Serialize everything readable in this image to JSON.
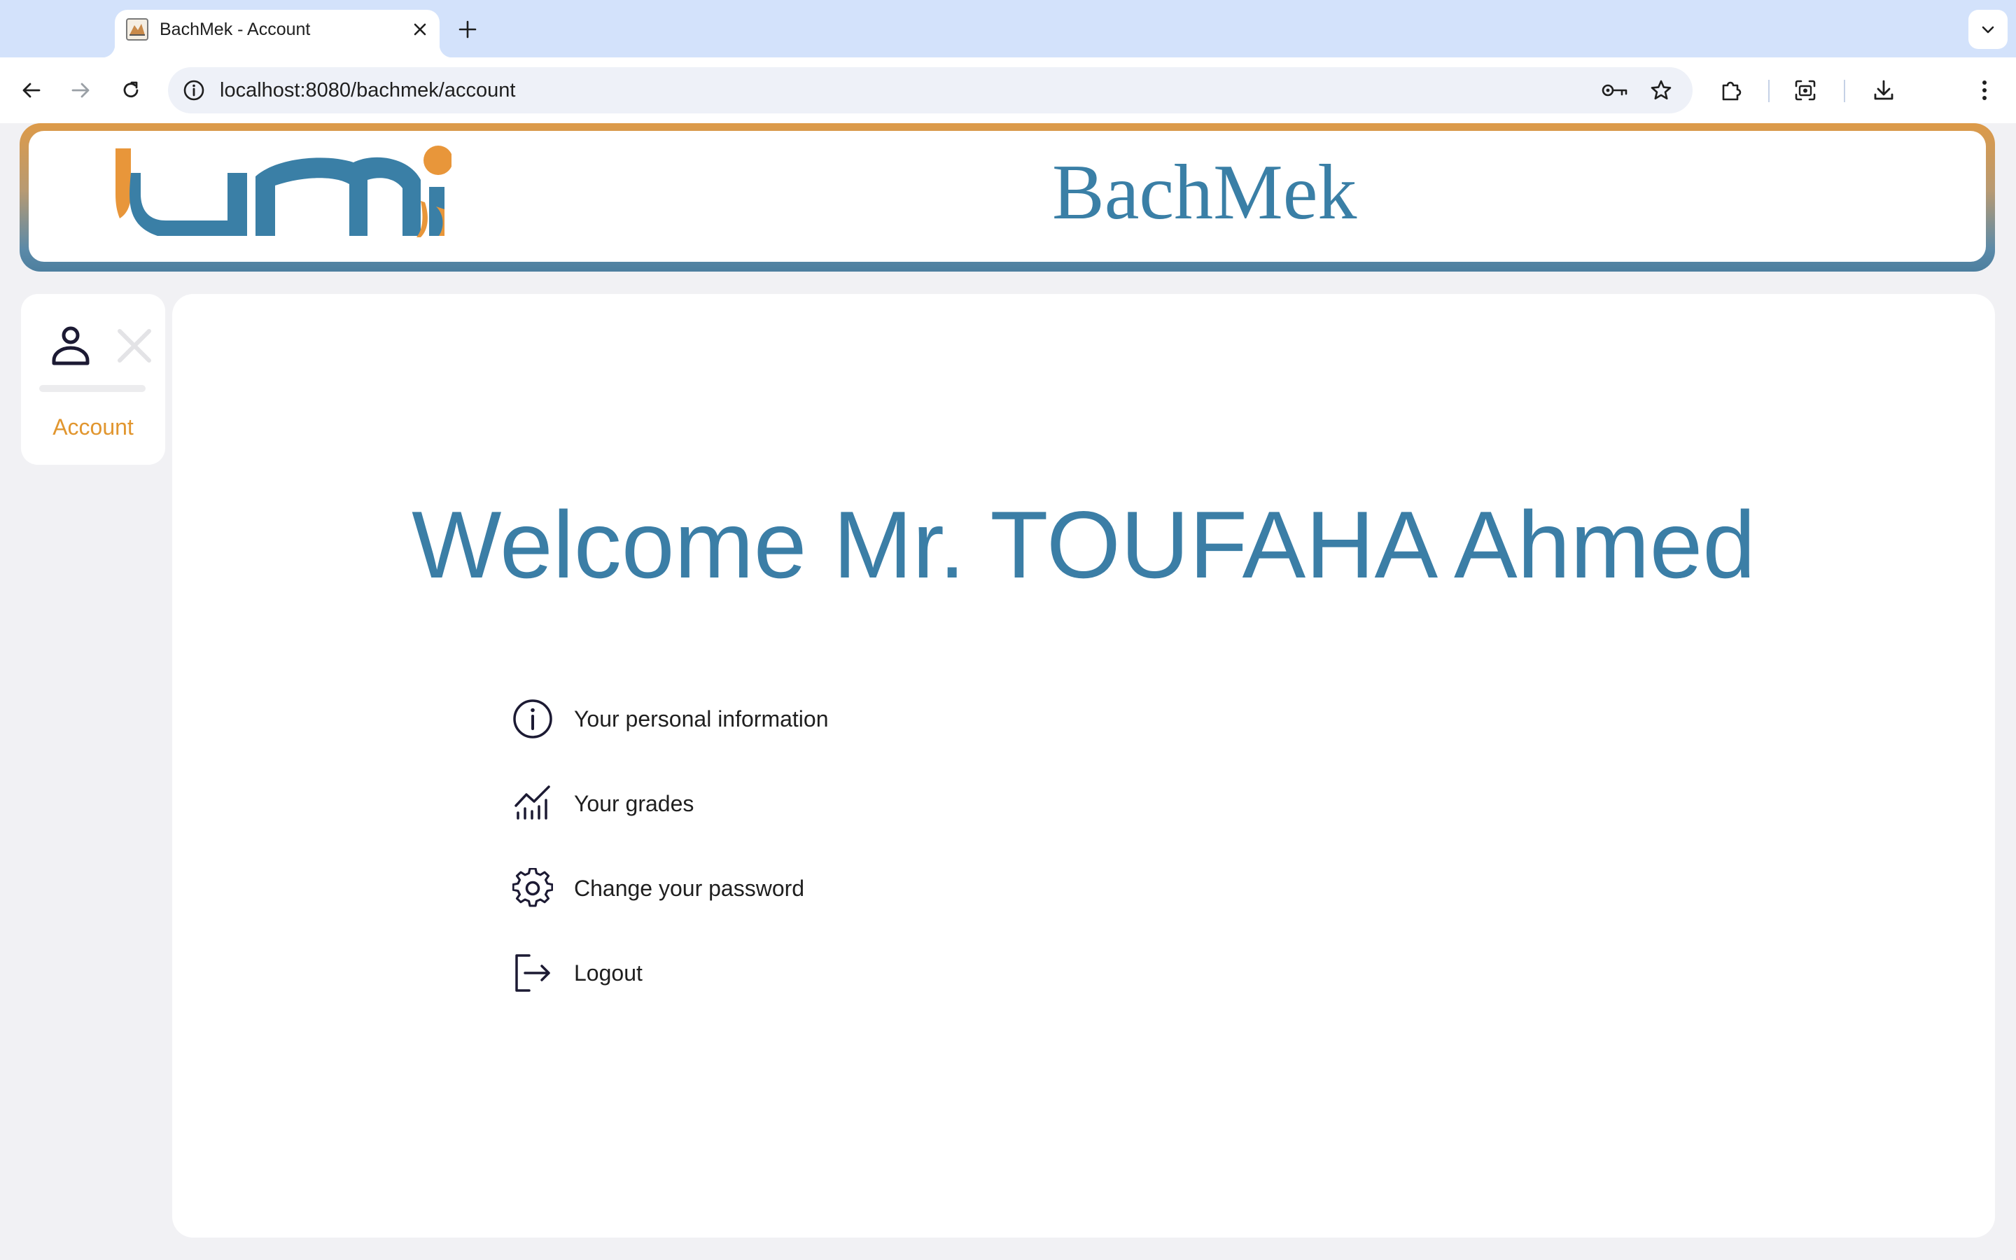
{
  "browser": {
    "tab_title": "BachMek - Account",
    "url": "localhost:8080/bachmek/account"
  },
  "header": {
    "site_title": "BachMek",
    "logo_name": "UMi logo"
  },
  "sidebar": {
    "items": [
      {
        "label": "Account",
        "icon": "user-icon"
      }
    ]
  },
  "main": {
    "welcome": "Welcome Mr. TOUFAHA Ahmed",
    "menu": [
      {
        "label": "Your personal information",
        "icon": "info-icon"
      },
      {
        "label": "Your grades",
        "icon": "chart-icon"
      },
      {
        "label": "Change your password",
        "icon": "gear-icon"
      },
      {
        "label": "Logout",
        "icon": "logout-icon"
      }
    ]
  },
  "colors": {
    "accent_blue": "#3b7ea6",
    "accent_orange": "#e1962f"
  }
}
